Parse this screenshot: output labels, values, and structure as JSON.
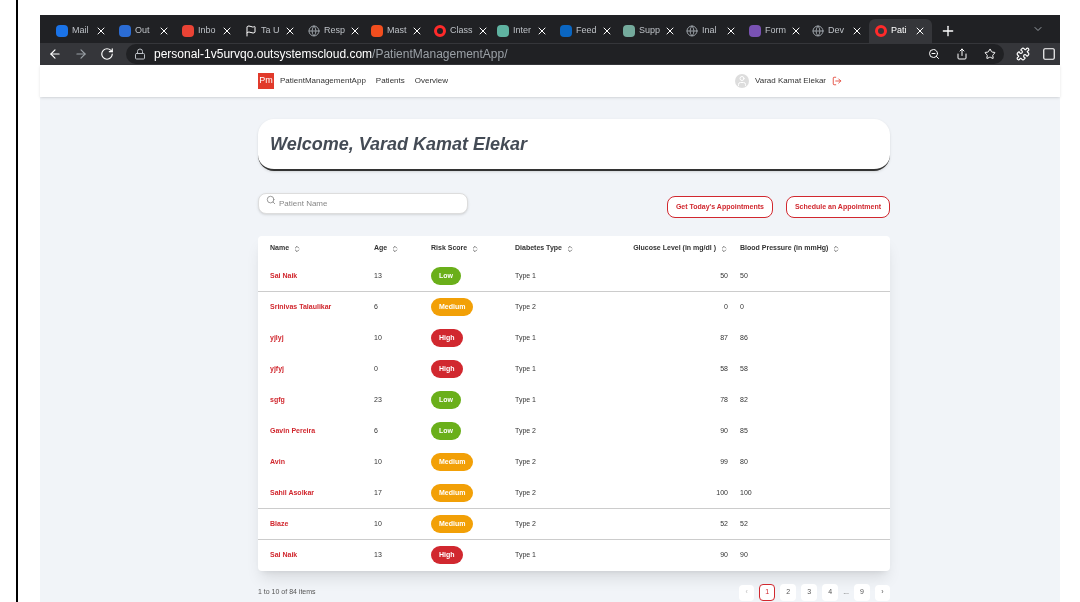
{
  "browser": {
    "tabs": [
      {
        "title": "Mail",
        "selected": false
      },
      {
        "title": "Out",
        "selected": false
      },
      {
        "title": "Inbo",
        "selected": false
      },
      {
        "title": "Ta U",
        "selected": false
      },
      {
        "title": "Resp",
        "selected": false
      },
      {
        "title": "Mast",
        "selected": false
      },
      {
        "title": "Class",
        "selected": false
      },
      {
        "title": "Inter",
        "selected": false
      },
      {
        "title": "Feed",
        "selected": false
      },
      {
        "title": "Supp",
        "selected": false
      },
      {
        "title": "Inal",
        "selected": false
      },
      {
        "title": "Form",
        "selected": false
      },
      {
        "title": "Dev",
        "selected": false
      },
      {
        "title": "Pati",
        "selected": true
      }
    ],
    "url_host": "personal-1v5urvqo.outsystemscloud.com",
    "url_path": "/PatientManagementApp/"
  },
  "app": {
    "logo": "Pm",
    "name": "PatientManagementApp",
    "nav": [
      "Patients",
      "Overview"
    ],
    "user": "Varad Kamat Elekar"
  },
  "welcome": "Welcome, Varad Kamat Elekar",
  "search": {
    "placeholder": "Patient Name"
  },
  "buttons": [
    "Get Today's Appointments",
    "Schedule an Appointment"
  ],
  "table": {
    "columns": [
      "Name",
      "Age",
      "Risk Score",
      "Diabetes Type",
      "Glucose Level (in mg/dl )",
      "Blood Pressure (in mmHg)"
    ],
    "rows": [
      {
        "name": "Sai Naik",
        "age": "13",
        "risk": "Low",
        "color": "#6aaf1a",
        "type": "Type 1",
        "glucose": "50",
        "bp": "50",
        "divider": true
      },
      {
        "name": "Srinivas Talaulikar",
        "age": "6",
        "risk": "Medium",
        "color": "#f2a007",
        "type": "Type 2",
        "glucose": "0",
        "bp": "0",
        "divider": false
      },
      {
        "name": "yjlyj",
        "age": "10",
        "risk": "High",
        "color": "#d1282f",
        "type": "Type 1",
        "glucose": "87",
        "bp": "86",
        "divider": false
      },
      {
        "name": "yjfyj",
        "age": "0",
        "risk": "High",
        "color": "#d1282f",
        "type": "Type 1",
        "glucose": "58",
        "bp": "58",
        "divider": false
      },
      {
        "name": "sgfg",
        "age": "23",
        "risk": "Low",
        "color": "#6aaf1a",
        "type": "Type 1",
        "glucose": "78",
        "bp": "82",
        "divider": false
      },
      {
        "name": "Gavin Pereira",
        "age": "6",
        "risk": "Low",
        "color": "#6aaf1a",
        "type": "Type 2",
        "glucose": "90",
        "bp": "85",
        "divider": false
      },
      {
        "name": "Avin",
        "age": "10",
        "risk": "Medium",
        "color": "#f2a007",
        "type": "Type 2",
        "glucose": "99",
        "bp": "80",
        "divider": false
      },
      {
        "name": "Sahil Asolkar",
        "age": "17",
        "risk": "Medium",
        "color": "#f2a007",
        "type": "Type 2",
        "glucose": "100",
        "bp": "100",
        "divider": true
      },
      {
        "name": "Blaze",
        "age": "10",
        "risk": "Medium",
        "color": "#f2a007",
        "type": "Type 2",
        "glucose": "52",
        "bp": "52",
        "divider": true
      },
      {
        "name": "Sai Naik",
        "age": "13",
        "risk": "High",
        "color": "#d1282f",
        "type": "Type 1",
        "glucose": "90",
        "bp": "90",
        "divider": false
      }
    ]
  },
  "pagination": {
    "summary": "1 to 10 of 84 items",
    "prev": "‹",
    "next": "›",
    "ellipsis": "...",
    "pages": [
      {
        "label": "1",
        "selected": true
      },
      {
        "label": "2",
        "selected": false
      },
      {
        "label": "3",
        "selected": false
      },
      {
        "label": "4",
        "selected": false
      },
      {
        "label": "9",
        "selected": false
      }
    ]
  }
}
